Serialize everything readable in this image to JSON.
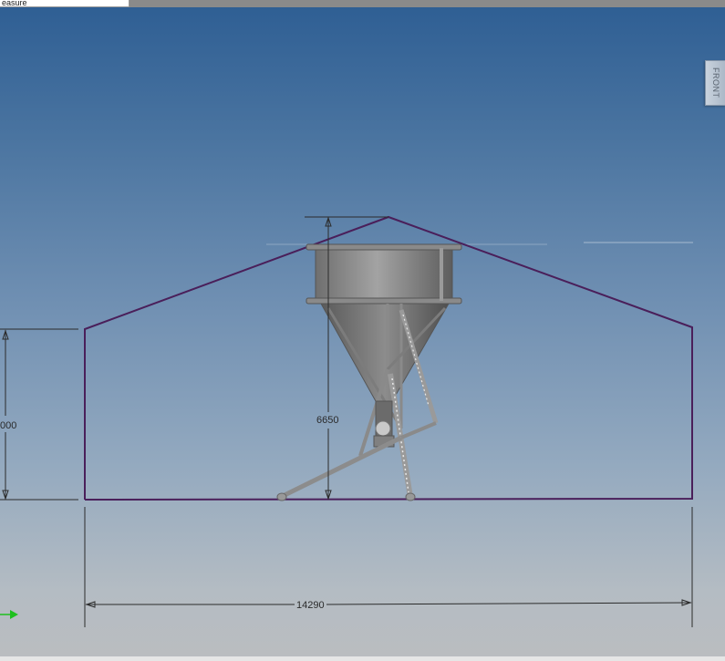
{
  "command_box": {
    "text": "easure"
  },
  "viewcube": {
    "label": "FRONT"
  },
  "dimensions": {
    "width": "14290",
    "height": "6650",
    "wall_height": "000"
  },
  "colors": {
    "outline": "#4a1f5a",
    "dimension_line": "#2b2b2b",
    "axis_arrow": "#1ec01e"
  }
}
